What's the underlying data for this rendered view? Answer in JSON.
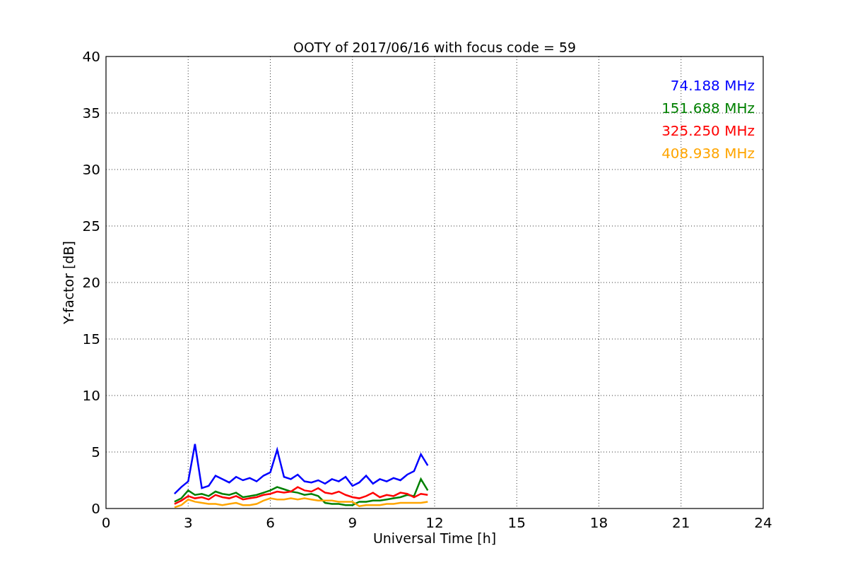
{
  "chart_data": {
    "type": "line",
    "title": "OOTY of 2017/06/16 with focus code = 59",
    "xlabel": "Universal Time [h]",
    "ylabel": "Y-factor [dB]",
    "x": [
      2.5,
      2.75,
      3.0,
      3.25,
      3.5,
      3.75,
      4.0,
      4.25,
      4.5,
      4.75,
      5.0,
      5.25,
      5.5,
      5.75,
      6.0,
      6.25,
      6.5,
      6.75,
      7.0,
      7.25,
      7.5,
      7.75,
      8.0,
      8.25,
      8.5,
      8.75,
      9.0,
      9.25,
      9.5,
      9.75,
      10.0,
      10.25,
      10.5,
      10.75,
      11.0,
      11.25,
      11.5,
      11.75
    ],
    "series": [
      {
        "name": "74.188 MHz",
        "color": "#0000ff",
        "values": [
          1.3,
          1.9,
          2.4,
          5.7,
          1.8,
          2.0,
          2.9,
          2.6,
          2.3,
          2.8,
          2.5,
          2.7,
          2.4,
          2.9,
          3.2,
          5.2,
          2.8,
          2.6,
          3.0,
          2.4,
          2.3,
          2.5,
          2.2,
          2.6,
          2.4,
          2.8,
          2.0,
          2.3,
          2.9,
          2.2,
          2.6,
          2.4,
          2.7,
          2.5,
          3.0,
          3.3,
          4.8,
          3.8
        ]
      },
      {
        "name": "151.688 MHz",
        "color": "#008000",
        "values": [
          0.6,
          0.9,
          1.6,
          1.2,
          1.3,
          1.1,
          1.5,
          1.3,
          1.2,
          1.4,
          1.0,
          1.1,
          1.2,
          1.4,
          1.6,
          1.9,
          1.7,
          1.5,
          1.4,
          1.2,
          1.3,
          1.1,
          0.5,
          0.4,
          0.4,
          0.3,
          0.3,
          0.6,
          0.6,
          0.7,
          0.7,
          0.8,
          0.9,
          1.0,
          1.2,
          1.1,
          2.6,
          1.6
        ]
      },
      {
        "name": "325.250 MHz",
        "color": "#ff0000",
        "values": [
          0.4,
          0.7,
          1.1,
          0.9,
          1.0,
          0.8,
          1.2,
          1.0,
          0.9,
          1.1,
          0.8,
          0.9,
          1.0,
          1.2,
          1.3,
          1.5,
          1.4,
          1.5,
          1.9,
          1.6,
          1.5,
          1.8,
          1.4,
          1.3,
          1.5,
          1.2,
          1.0,
          0.9,
          1.1,
          1.4,
          1.0,
          1.2,
          1.1,
          1.4,
          1.3,
          1.0,
          1.3,
          1.2
        ]
      },
      {
        "name": "408.938 MHz",
        "color": "#ffa500",
        "values": [
          0.1,
          0.3,
          0.8,
          0.6,
          0.5,
          0.4,
          0.4,
          0.3,
          0.4,
          0.5,
          0.3,
          0.3,
          0.4,
          0.7,
          0.9,
          0.8,
          0.8,
          0.9,
          0.8,
          0.9,
          0.8,
          0.7,
          0.7,
          0.7,
          0.6,
          0.6,
          0.6,
          0.2,
          0.3,
          0.3,
          0.3,
          0.4,
          0.4,
          0.5,
          0.5,
          0.5,
          0.5,
          0.6
        ]
      }
    ],
    "grid": true,
    "xlim": [
      0,
      24
    ],
    "ylim": [
      0,
      40
    ],
    "xticks": [
      0,
      3,
      6,
      9,
      12,
      15,
      18,
      21,
      24
    ],
    "yticks": [
      0,
      5,
      10,
      15,
      20,
      25,
      30,
      35,
      40
    ]
  }
}
